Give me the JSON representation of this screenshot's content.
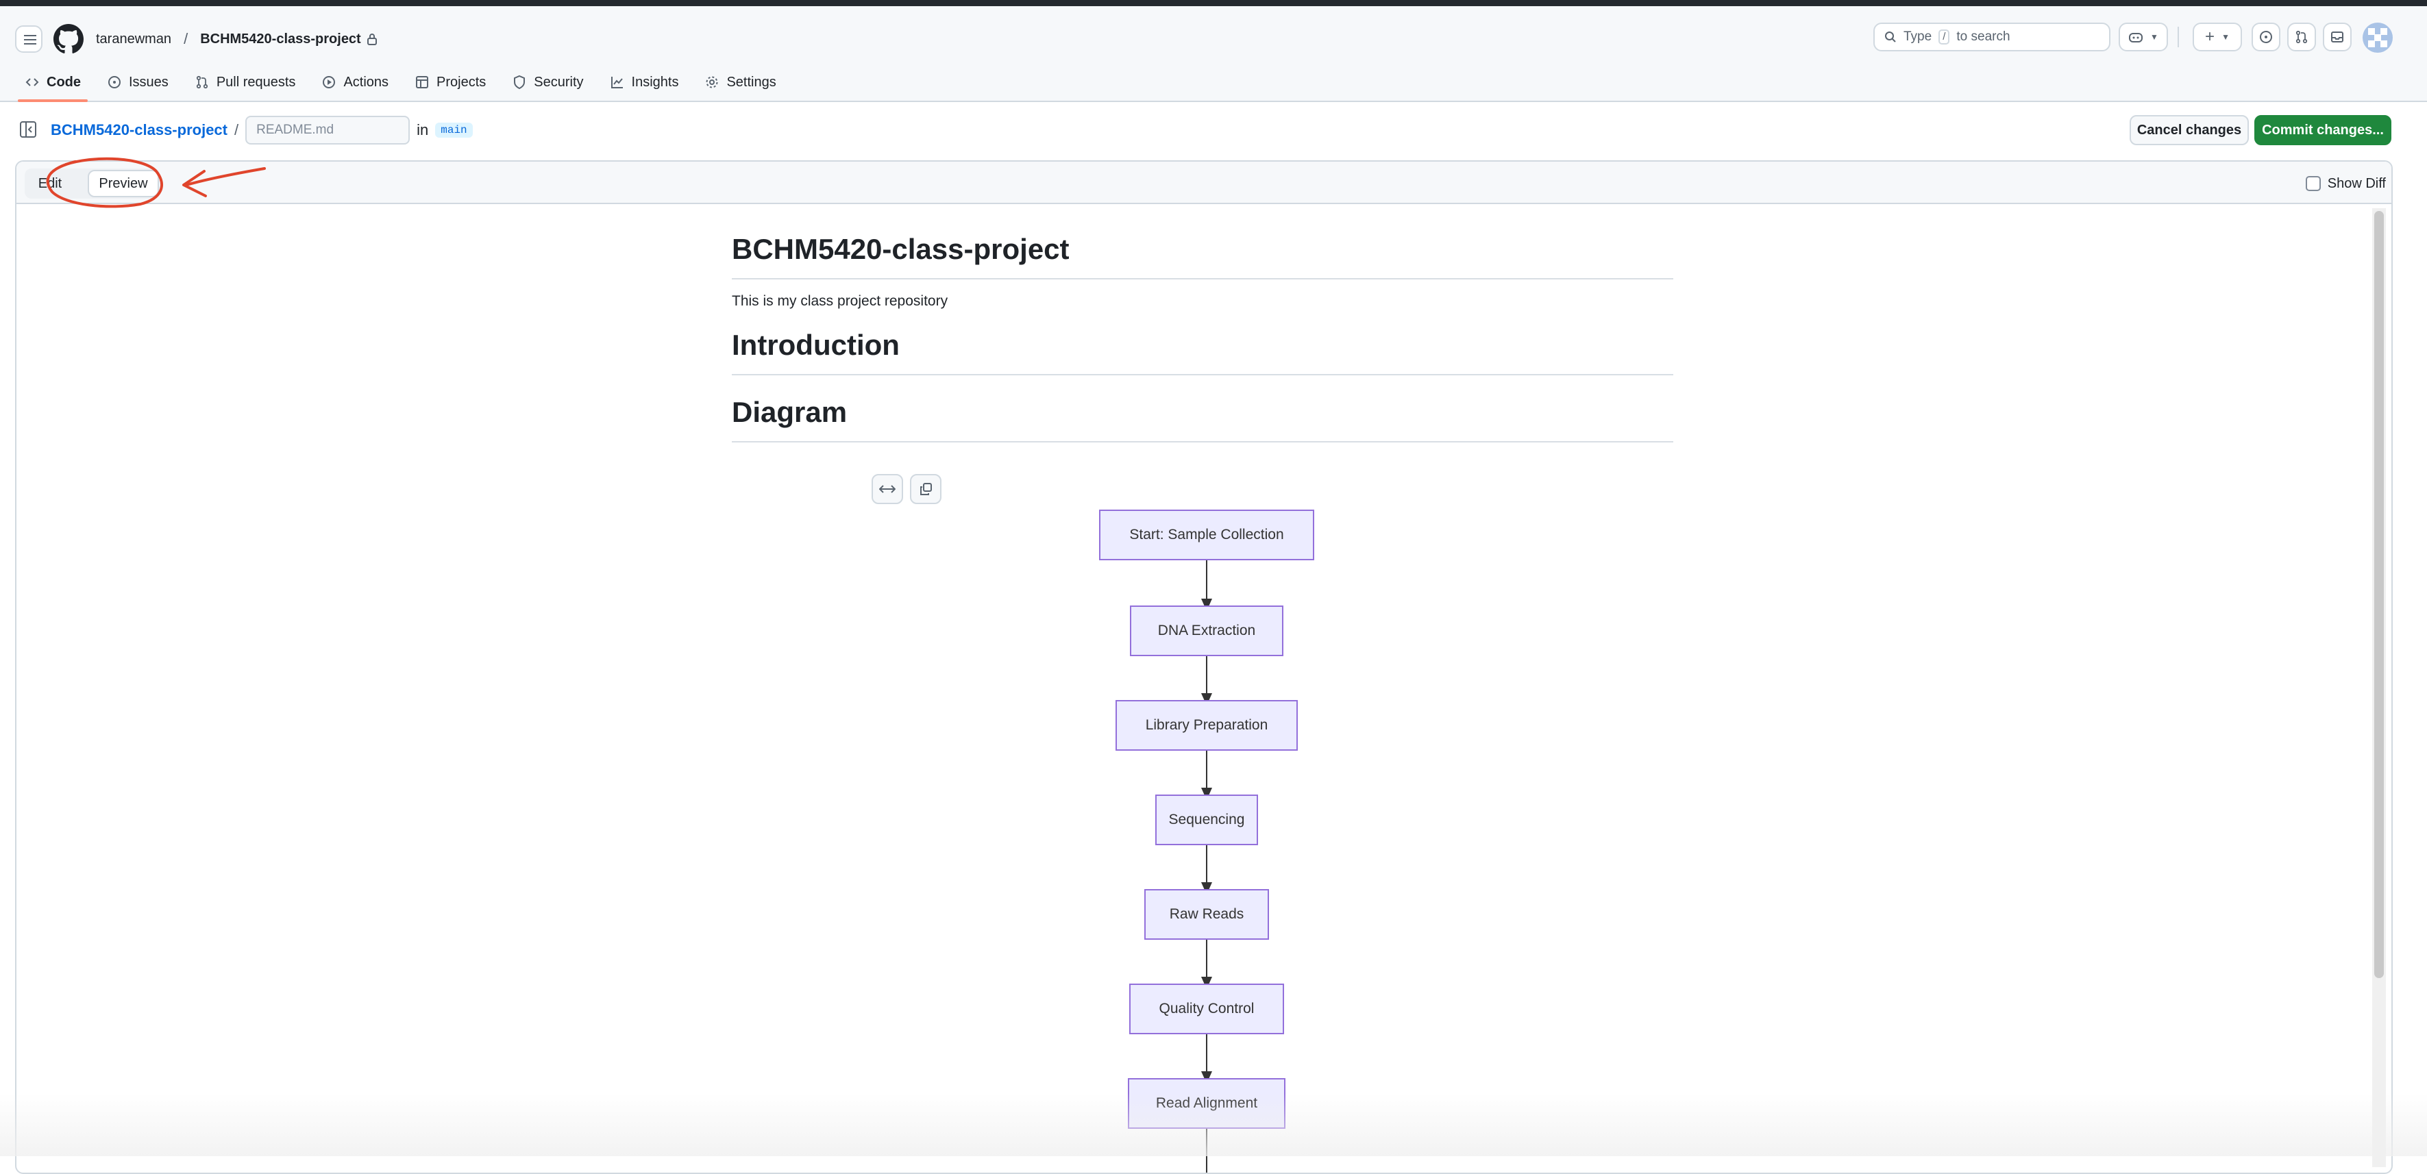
{
  "header": {
    "owner": "taranewman",
    "separator": "/",
    "repo": "BCHM5420-class-project",
    "search_prefix": "Type",
    "search_key": "/",
    "search_suffix": "to search",
    "tabs": [
      {
        "label": "Code",
        "icon": "code-icon",
        "active": true
      },
      {
        "label": "Issues",
        "icon": "issue-icon"
      },
      {
        "label": "Pull requests",
        "icon": "pull-request-icon"
      },
      {
        "label": "Actions",
        "icon": "play-icon"
      },
      {
        "label": "Projects",
        "icon": "table-icon"
      },
      {
        "label": "Security",
        "icon": "shield-icon"
      },
      {
        "label": "Insights",
        "icon": "graph-icon"
      },
      {
        "label": "Settings",
        "icon": "gear-icon"
      }
    ]
  },
  "editor": {
    "repo_link": "BCHM5420-class-project",
    "path_sep": "/",
    "filename_placeholder": "README.md",
    "in_label": "in",
    "branch": "main",
    "cancel_label": "Cancel changes",
    "commit_label": "Commit changes...",
    "edit_tab": "Edit",
    "preview_tab": "Preview",
    "show_diff": "Show Diff"
  },
  "preview": {
    "title": "BCHM5420-class-project",
    "description": "This is my class project repository",
    "h_intro": "Introduction",
    "h_diagram": "Diagram",
    "nodes": [
      "Start: Sample Collection",
      "DNA Extraction",
      "Library Preparation",
      "Sequencing",
      "Raw Reads",
      "Quality Control",
      "Read Alignment"
    ]
  },
  "colors": {
    "accent_tab": "#fd8c73",
    "commit_green": "#1f883d",
    "link_blue": "#0969da",
    "node_fill": "#ececff",
    "node_stroke": "#9370db",
    "annotation_red": "#e0452c"
  }
}
